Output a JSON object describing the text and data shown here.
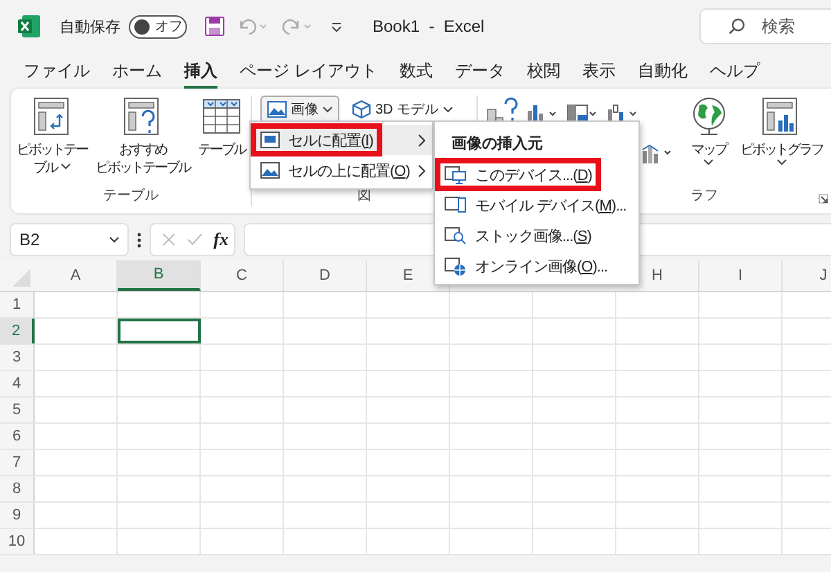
{
  "titlebar": {
    "autosave_label": "自動保存",
    "autosave": {
      "on": false,
      "label": "オフ"
    },
    "title": "Book1  -  Excel",
    "search_placeholder": "検索"
  },
  "tabs": [
    {
      "label": "ファイル",
      "selected": false
    },
    {
      "label": "ホーム",
      "selected": false
    },
    {
      "label": "挿入",
      "selected": true
    },
    {
      "label": "ページ レイアウト",
      "selected": false
    },
    {
      "label": "数式",
      "selected": false
    },
    {
      "label": "データ",
      "selected": false
    },
    {
      "label": "校閲",
      "selected": false
    },
    {
      "label": "表示",
      "selected": false
    },
    {
      "label": "自動化",
      "selected": false
    },
    {
      "label": "ヘルプ",
      "selected": false
    }
  ],
  "ribbon": {
    "groups": [
      {
        "kind": "large",
        "label": "テーブル",
        "buttons": [
          {
            "lines": [
              "ピボットテー",
              "ブル"
            ],
            "dropdown": true
          },
          {
            "lines": [
              "おすすめ",
              "ピボットテーブル"
            ],
            "dropdown": false
          },
          {
            "lines": [
              "テーブル"
            ],
            "dropdown": false
          }
        ]
      },
      {
        "kind": "small",
        "label": "図",
        "buttons": [
          {
            "label": "画像",
            "pressed": true
          },
          {
            "label": "3D モデル",
            "pressed": false
          }
        ]
      },
      {
        "kind": "chart",
        "label": "ラフ",
        "buttons": [
          {
            "lines": [
              "マップ"
            ],
            "dropdown": true
          },
          {
            "lines": [
              "ピボットグラフ"
            ],
            "dropdown": true
          }
        ]
      }
    ]
  },
  "formula_bar": {
    "name_box": "B2",
    "function_label": "fx"
  },
  "sheet": {
    "columns": [
      {
        "label": "A",
        "selected": false
      },
      {
        "label": "B",
        "selected": true
      },
      {
        "label": "C",
        "selected": false
      },
      {
        "label": "D",
        "selected": false
      },
      {
        "label": "E",
        "selected": false
      }
    ],
    "columns_right": [
      {
        "label": "H",
        "selected": false
      },
      {
        "label": "I",
        "selected": false
      },
      {
        "label": "J",
        "selected": false
      }
    ],
    "rows": [
      {
        "label": "1",
        "selected": false
      },
      {
        "label": "2",
        "selected": true
      },
      {
        "label": "3",
        "selected": false
      },
      {
        "label": "4",
        "selected": false
      },
      {
        "label": "5",
        "selected": false
      },
      {
        "label": "6",
        "selected": false
      },
      {
        "label": "7",
        "selected": false
      },
      {
        "label": "8",
        "selected": false
      },
      {
        "label": "9",
        "selected": false
      },
      {
        "label": "10",
        "selected": false
      }
    ]
  },
  "picture_menu": {
    "items": [
      {
        "label": "セルに配置(",
        "access_key": "I",
        "label_end": ")",
        "selected": true,
        "annotated": true,
        "submenu": true
      },
      {
        "label": "セルの上に配置(",
        "access_key": "O",
        "label_end": ")",
        "selected": false,
        "annotated": false,
        "submenu": true
      }
    ]
  },
  "source_menu": {
    "header": "画像の挿入元",
    "items": [
      {
        "label": "このデバイス...(",
        "access_key": "D",
        "label_end": ")",
        "selected": false,
        "annotated": true,
        "submenu": false
      },
      {
        "label": "モバイル デバイス(",
        "access_key": "M",
        "label_end": ")...",
        "selected": false,
        "annotated": false,
        "submenu": false
      },
      {
        "label": "ストック画像...(",
        "access_key": "S",
        "label_end": ")",
        "selected": false,
        "annotated": false,
        "submenu": false
      },
      {
        "label": "オンライン画像(",
        "access_key": "O",
        "label_end": ")...",
        "selected": false,
        "annotated": false,
        "submenu": false
      }
    ]
  }
}
